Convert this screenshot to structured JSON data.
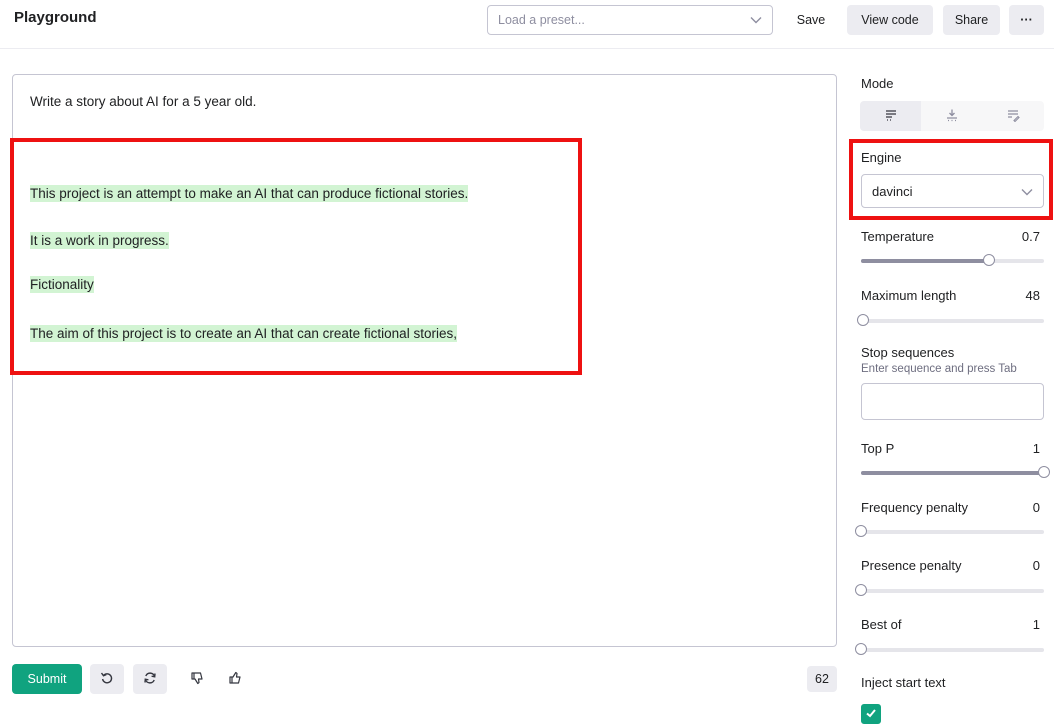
{
  "header": {
    "title": "Playground",
    "preset_placeholder": "Load a preset...",
    "save_label": "Save",
    "view_code_label": "View code",
    "share_label": "Share",
    "more_label": "···"
  },
  "editor": {
    "prompt": "Write a story about AI for a 5 year old.",
    "completion_lines": [
      "This project is an attempt to make an AI that can produce fictional stories.",
      "It is a work in progress.",
      "Fictionality",
      "The aim of this project is to create an AI that can create fictional stories,"
    ],
    "highlight_color": "#d2f4d3"
  },
  "footer": {
    "submit_label": "Submit",
    "token_count": "62",
    "icons": [
      "undo-icon",
      "regenerate-icon",
      "thumbs-down-icon",
      "thumbs-up-icon"
    ]
  },
  "settings": {
    "mode_label": "Mode",
    "modes": [
      "complete-mode-icon",
      "insert-mode-icon",
      "edit-mode-icon"
    ],
    "active_mode": 0,
    "engine_label": "Engine",
    "engine_value": "davinci",
    "temperature": {
      "label": "Temperature",
      "value": "0.7",
      "fraction": 0.7
    },
    "max_length": {
      "label": "Maximum length",
      "value": "48",
      "fraction": 0.01
    },
    "stop_sequences": {
      "label": "Stop sequences",
      "hint": "Enter sequence and press Tab"
    },
    "top_p": {
      "label": "Top P",
      "value": "1",
      "fraction": 1.0
    },
    "frequency_penalty": {
      "label": "Frequency penalty",
      "value": "0",
      "fraction": 0.0
    },
    "presence_penalty": {
      "label": "Presence penalty",
      "value": "0",
      "fraction": 0.0
    },
    "best_of": {
      "label": "Best of",
      "value": "1",
      "fraction": 0.0
    },
    "inject_start_text": {
      "label": "Inject start text",
      "checked": true
    }
  },
  "colors": {
    "accent": "#10a37f",
    "annotation": "#ee1111"
  }
}
